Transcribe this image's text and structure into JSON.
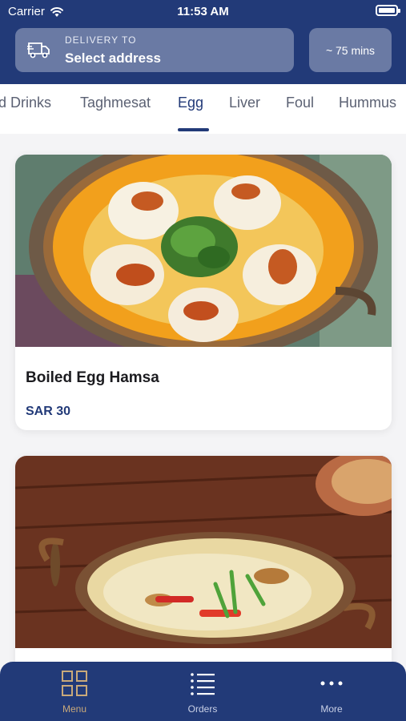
{
  "status_bar": {
    "carrier": "Carrier",
    "time": "11:53 AM"
  },
  "header": {
    "delivery_label": "DELIVERY TO",
    "address": "Select address",
    "eta": "~ 75 mins"
  },
  "tabs": [
    {
      "label": "d Drinks",
      "active": false
    },
    {
      "label": "Taghmesat",
      "active": false
    },
    {
      "label": "Egg",
      "active": true
    },
    {
      "label": "Liver",
      "active": false
    },
    {
      "label": "Foul",
      "active": false
    },
    {
      "label": "Hummus",
      "active": false
    }
  ],
  "items": [
    {
      "title": "Boiled Egg Hamsa",
      "price": "SAR 30",
      "icon": "boiled-egg-dish-photo"
    },
    {
      "title": "",
      "price": "",
      "icon": "cheese-egg-skillet-photo"
    }
  ],
  "bottom_nav": [
    {
      "label": "Menu",
      "icon": "grid-icon",
      "active": true
    },
    {
      "label": "Orders",
      "icon": "list-icon",
      "active": false
    },
    {
      "label": "More",
      "icon": "more-dots-icon",
      "active": false
    }
  ],
  "colors": {
    "primary": "#223a78",
    "accent": "#c9a97a",
    "background": "#f4f4f6"
  }
}
